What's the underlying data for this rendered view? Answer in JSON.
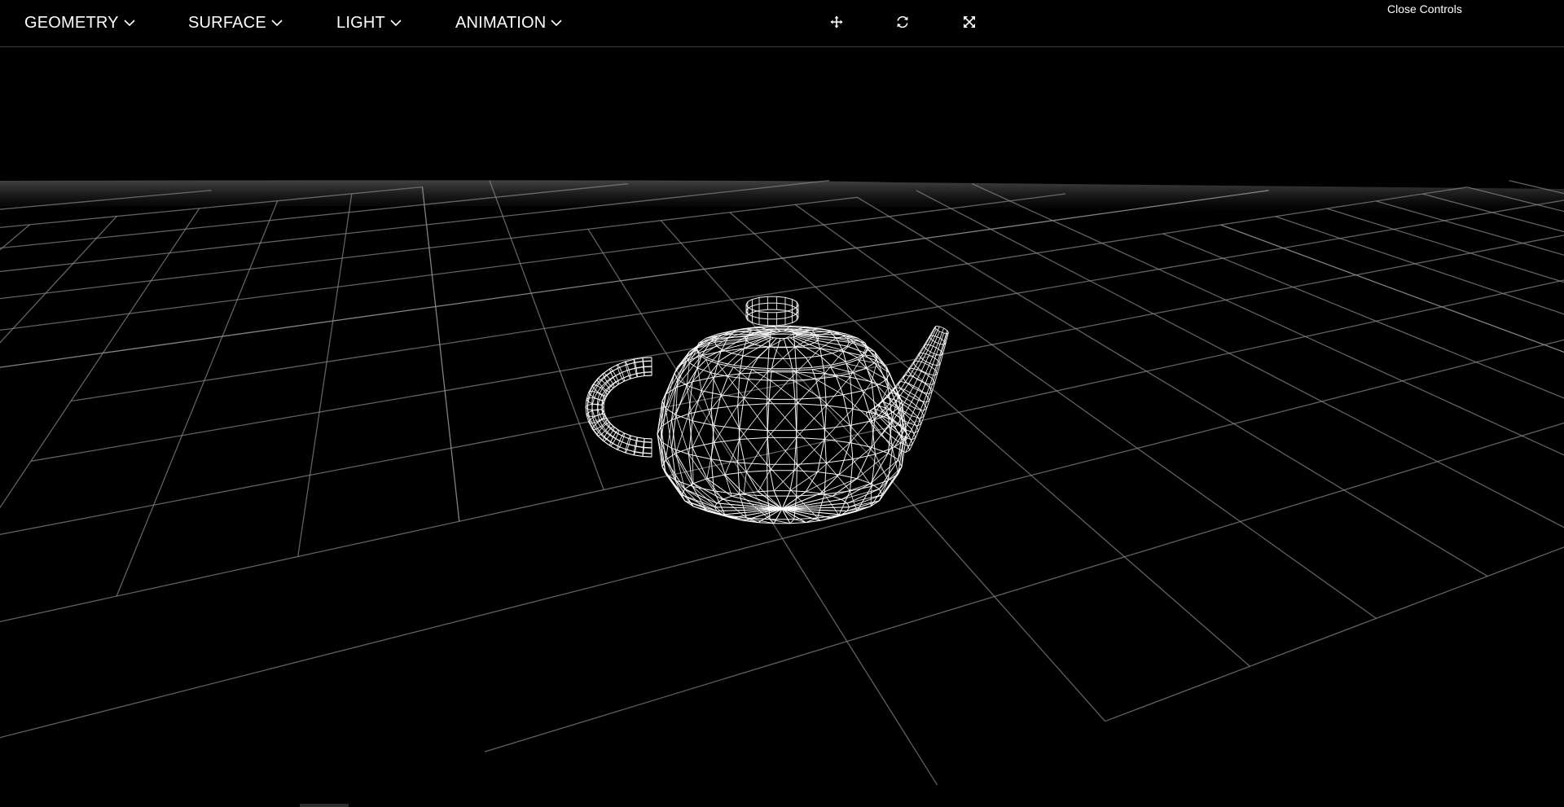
{
  "menu": {
    "geometry": "GEOMETRY",
    "surface": "SURFACE",
    "light": "LIGHT",
    "animation": "ANIMATION"
  },
  "toolbar": {
    "move_icon": "move-arrows-icon",
    "reset_icon": "rotate-reset-icon",
    "fullscreen_icon": "fullscreen-expand-icon"
  },
  "controls": {
    "close_label": "Close Controls"
  },
  "scene": {
    "model": "teapot",
    "render_mode": "wireframe",
    "ground": "grid",
    "background_color": "#000000",
    "grid_color": "#8a8a8a",
    "wire_color": "#ffffff"
  }
}
